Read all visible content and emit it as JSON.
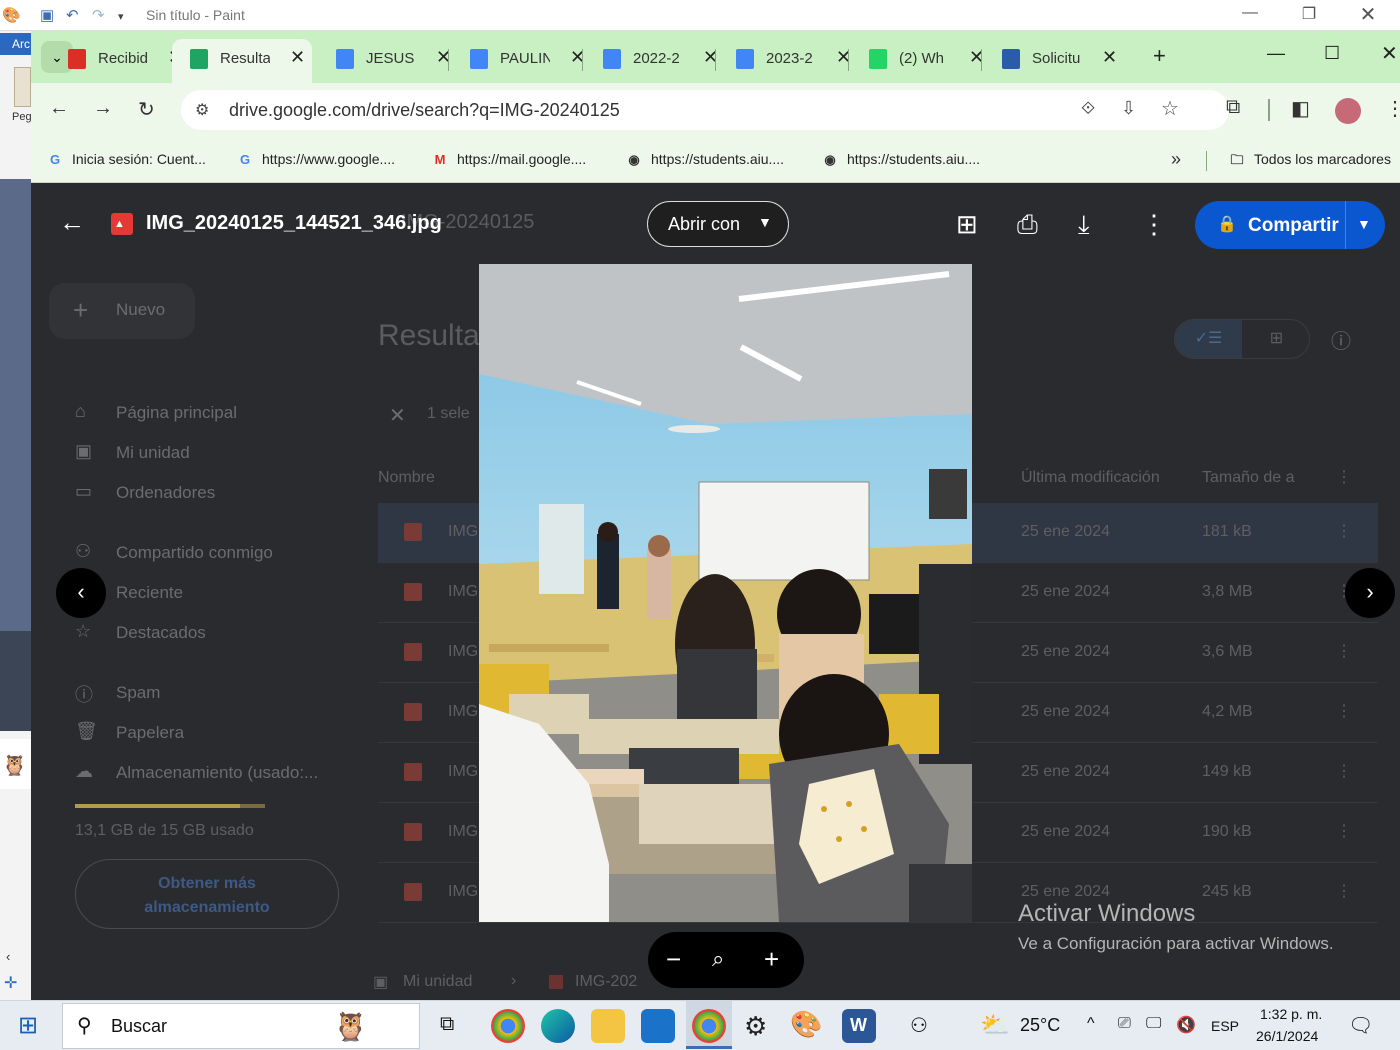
{
  "paint": {
    "title": "Sin título - Paint",
    "file_tab": "Arc",
    "paste_label": "Peg"
  },
  "chrome": {
    "tabs": [
      {
        "label": "Recibid",
        "icon": "gmail-icon",
        "color": "#d93025"
      },
      {
        "label": "Resulta",
        "icon": "google-drive-icon",
        "color": "#1fa463"
      },
      {
        "label": "JESUS",
        "icon": "google-docs-icon",
        "color": "#4285f4"
      },
      {
        "label": "PAULIN",
        "icon": "google-docs-icon",
        "color": "#4285f4"
      },
      {
        "label": "2022-2",
        "icon": "google-docs-icon",
        "color": "#4285f4"
      },
      {
        "label": "2023-2",
        "icon": "google-docs-icon",
        "color": "#4285f4"
      },
      {
        "label": "(2) Wh",
        "icon": "whatsapp-icon",
        "color": "#25d366"
      },
      {
        "label": "Solicitu",
        "icon": "gov-icon",
        "color": "#2a5caa"
      }
    ],
    "url": "drive.google.com/drive/search?q=IMG-20240125",
    "bookmarks": [
      {
        "label": "Inicia sesión: Cuent...",
        "icon": "google-icon",
        "glyph": "G",
        "color": "#4285f4"
      },
      {
        "label": "https://www.google....",
        "icon": "google-icon",
        "glyph": "G",
        "color": "#4285f4"
      },
      {
        "label": "https://mail.google....",
        "icon": "gmail-icon",
        "glyph": "M",
        "color": "#d93025"
      },
      {
        "label": "https://students.aiu....",
        "icon": "globe-icon",
        "glyph": "◉",
        "color": "#333333"
      },
      {
        "label": "https://students.aiu....",
        "icon": "globe-icon",
        "glyph": "◉",
        "color": "#333333"
      }
    ],
    "all_bookmarks": "Todos los marcadores"
  },
  "drive": {
    "search_echo": "IMG-20240125",
    "new_label": "Nuevo",
    "results_title": "Resulta",
    "selected_label": "1 sele",
    "nav": [
      {
        "label": "Página principal",
        "icon": "home-icon"
      },
      {
        "label": "Mi unidad",
        "icon": "drive-icon"
      },
      {
        "label": "Ordenadores",
        "icon": "computer-icon"
      },
      {
        "label": "Compartido conmigo",
        "icon": "people-icon"
      },
      {
        "label": "Reciente",
        "icon": "clock-icon"
      },
      {
        "label": "Destacados",
        "icon": "star-icon"
      },
      {
        "label": "Spam",
        "icon": "spam-icon"
      },
      {
        "label": "Papelera",
        "icon": "trash-icon"
      },
      {
        "label": "Almacenamiento (usado:...",
        "icon": "cloud-icon"
      }
    ],
    "storage_text": "13,1 GB de 15 GB usado",
    "storage_used_fraction": 0.87,
    "get_more_storage": "Obtener más almacenamiento",
    "columns": {
      "name": "Nombre",
      "modified": "Última modificación",
      "size": "Tamaño de a"
    },
    "rows": [
      {
        "name": "IMG",
        "date": "25 ene 2024",
        "size": "181 kB"
      },
      {
        "name": "IMG",
        "date": "25 ene 2024",
        "size": "3,8 MB"
      },
      {
        "name": "IMG",
        "date": "25 ene 2024",
        "size": "3,6 MB"
      },
      {
        "name": "IMG",
        "date": "25 ene 2024",
        "size": "4,2 MB"
      },
      {
        "name": "IMG",
        "date": "25 ene 2024",
        "size": "149 kB"
      },
      {
        "name": "IMG",
        "date": "25 ene 2024",
        "size": "190 kB"
      },
      {
        "name": "IMG",
        "date": "25 ene 2024",
        "size": "245 kB"
      }
    ],
    "breadcrumb_root": "Mi unidad",
    "breadcrumb_item": "IMG-202"
  },
  "viewer": {
    "filename": "IMG_20240125_144521_346.jpg",
    "open_with": "Abrir con",
    "share": "Compartir"
  },
  "watermark": {
    "title": "Activar Windows",
    "subtitle": "Ve a Configuración para activar Windows."
  },
  "taskbar": {
    "search_placeholder": "Buscar",
    "weather": "25°C",
    "language": "ESP",
    "time": "1:32 p. m.",
    "date": "26/1/2024"
  }
}
